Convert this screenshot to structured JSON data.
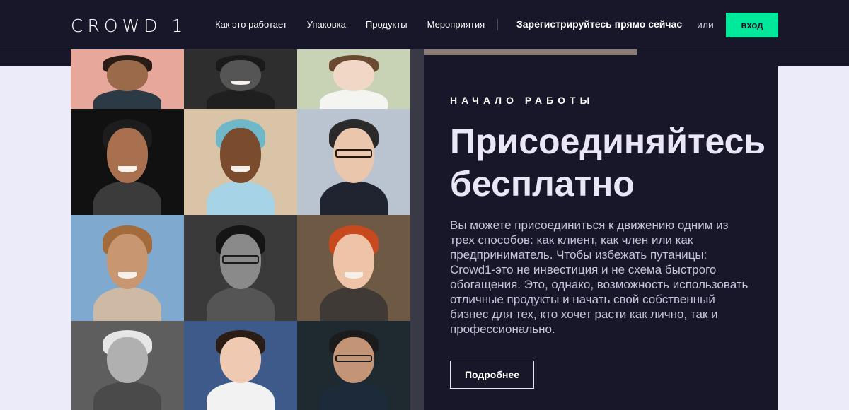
{
  "brand": {
    "logo_text": "CROWD 1",
    "accent": "#00e89a",
    "navy": "#171729"
  },
  "nav": {
    "links": [
      {
        "label": "Как это работает"
      },
      {
        "label": "Упаковка"
      },
      {
        "label": "Продукты"
      },
      {
        "label": "Мероприятия"
      }
    ],
    "register_label": "Зарегистрируйтесь прямо сейчас",
    "or_label": "или",
    "login_label": "вход"
  },
  "hero": {
    "eyebrow": "НАЧАЛО РАБОТЫ",
    "headline": "Присоединяйтесь бесплатно",
    "description": "Вы можете присоединиться к движению одним из трех способов: как клиент, как член или как предприниматель. Чтобы избежать путаницы: Crowd1-это не инвестиция и не схема быстрого обогащения. Это, однако, возможность использовать отличные продукты и начать свой собственный бизнес для тех, кто хочет расти как лично, так и профессионально.",
    "more_label": "Подробнее"
  },
  "photos": [
    {
      "bg": "#e8a79b",
      "skin": "#9b6a4a",
      "hair": "#2a1d18",
      "shirt": "#2b3a44"
    },
    {
      "bg": "#2e2e2e",
      "skin": "#555555",
      "hair": "#1a1a1a",
      "shirt": "#1f1f1f",
      "smile": true
    },
    {
      "bg": "#c8d3b6",
      "skin": "#f1d8c6",
      "hair": "#6b4a32",
      "shirt": "#f4f4f0"
    },
    {
      "bg": "#111111",
      "skin": "#a8704f",
      "hair": "#1d1d1d",
      "shirt": "#3b3b3b",
      "smile": true
    },
    {
      "bg": "#d9c4a8",
      "skin": "#7a4b2c",
      "hair": "#6fb8c9",
      "shirt": "#a7d3e6",
      "smile": true
    },
    {
      "bg": "#b9c4d0",
      "skin": "#eac6ad",
      "hair": "#2a2a2a",
      "shirt": "#1f2430",
      "glasses": true
    },
    {
      "bg": "#7fa9cf",
      "skin": "#c89772",
      "hair": "#a36a3c",
      "shirt": "#cdb9a4",
      "smile": true
    },
    {
      "bg": "#3a3a3a",
      "skin": "#8a8a8a",
      "hair": "#151515",
      "shirt": "#555555",
      "glasses": true
    },
    {
      "bg": "#6e5a44",
      "skin": "#efc3a8",
      "hair": "#c8491d",
      "shirt": "#3f3a36",
      "smile": true
    },
    {
      "bg": "#5e5e5e",
      "skin": "#b0b0b0",
      "hair": "#e6e6e6",
      "shirt": "#4a4a4a"
    },
    {
      "bg": "#3d5a8a",
      "skin": "#efc9b2",
      "hair": "#2a1d16",
      "shirt": "#f2f2f2"
    },
    {
      "bg": "#1e2a30",
      "skin": "#c39576",
      "hair": "#1b1b1b",
      "shirt": "#1d2a3a",
      "glasses": true
    }
  ]
}
